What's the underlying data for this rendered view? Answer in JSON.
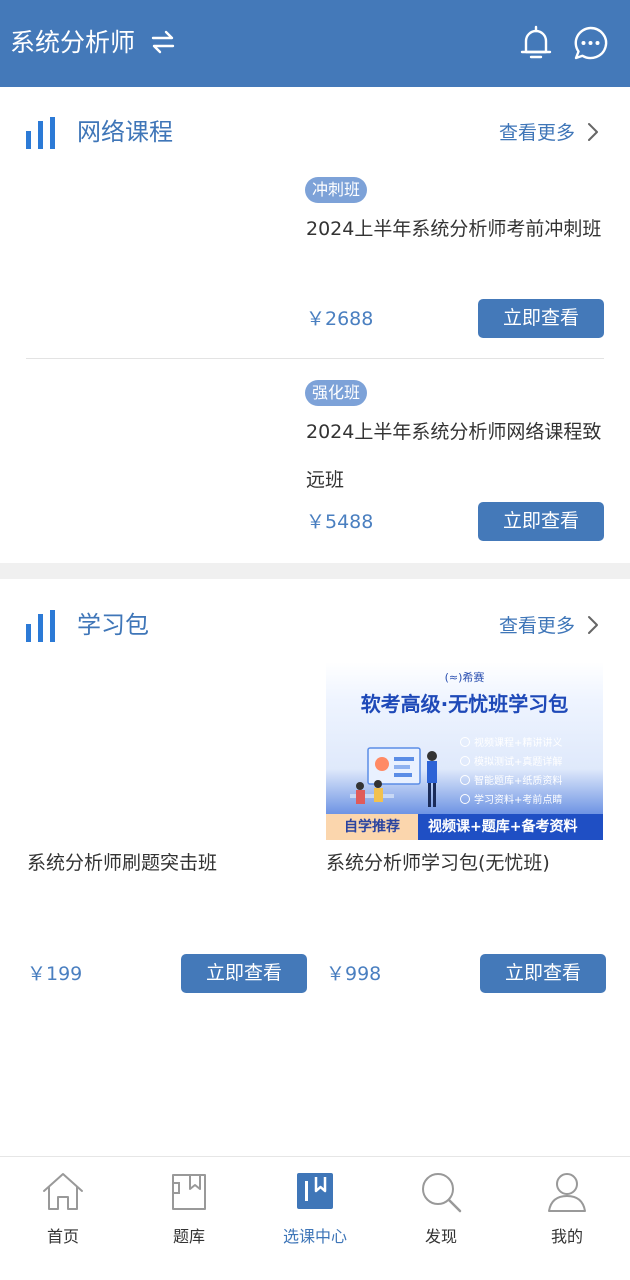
{
  "header": {
    "title": "系统分析师",
    "switch_icon": "swap-arrows-icon",
    "bell_icon": "bell-icon",
    "chat_icon": "chat-bubble-icon",
    "background": "#4479b9"
  },
  "online_courses": {
    "title": "网络课程",
    "more_label": "查看更多",
    "items": [
      {
        "tag": "冲刺班",
        "title": "2024上半年系统分析师考前冲刺班",
        "price": "￥2688",
        "button": "立即查看"
      },
      {
        "tag": "强化班",
        "title": "2024上半年系统分析师网络课程致远班",
        "price": "￥5488",
        "button": "立即查看"
      }
    ]
  },
  "study_packs": {
    "title": "学习包",
    "more_label": "查看更多",
    "items": [
      {
        "name": "系统分析师刷题突击班",
        "price": "￥199",
        "button": "立即查看"
      },
      {
        "name": "系统分析师学习包(无忧班)",
        "price": "￥998",
        "button": "立即查看",
        "banner": {
          "logo": "希赛",
          "headline": "软考高级·无忧班学习包",
          "features": [
            "视频课程+精讲讲义",
            "模拟测试+真题详解",
            "智能题库+纸质资料",
            "学习资料+考前点睛"
          ],
          "self_study": "自学推荐",
          "tagline": "视频课+题库+备考资料"
        }
      }
    ]
  },
  "tabbar": {
    "tabs": [
      {
        "label": "首页",
        "icon": "home-icon"
      },
      {
        "label": "题库",
        "icon": "question-bank-icon"
      },
      {
        "label": "选课中心",
        "icon": "course-center-icon",
        "active": true
      },
      {
        "label": "发现",
        "icon": "search-icon"
      },
      {
        "label": "我的",
        "icon": "user-icon"
      }
    ],
    "active_color": "#3f76b8"
  }
}
